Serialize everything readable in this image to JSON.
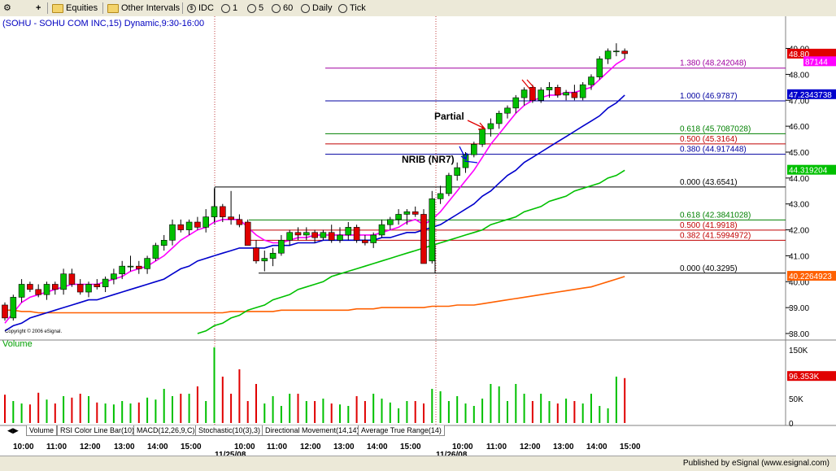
{
  "toolbar": {
    "items": [
      "Equities",
      "Other Intervals",
      "IDC",
      "1",
      "5",
      "60",
      "Daily",
      "Tick"
    ]
  },
  "chart_title": "(SOHU - SOHU COM INC,15) Dynamic,9:30-16:00",
  "copyright": "Copyright © 2006 eSignal.",
  "volume_label": "Volume",
  "annotations": [
    "Partial",
    "NRIB (NR7)"
  ],
  "price_axis": [
    "49.00",
    "48.00",
    "47.00",
    "46.00",
    "45.00",
    "44.00",
    "43.00",
    "42.00",
    "41.00",
    "40.00",
    "39.00",
    "38.00"
  ],
  "volume_axis": [
    "150K",
    "100K",
    "50K",
    "0"
  ],
  "time_axis": [
    "10:00",
    "11:00",
    "12:00",
    "13:00",
    "14:00",
    "15:00",
    "10:00",
    "11:00",
    "12:00",
    "13:00",
    "14:00",
    "15:00",
    "10:00",
    "11:00",
    "12:00",
    "13:00",
    "14:00",
    "15:00"
  ],
  "dates": [
    "11/25/08",
    "11/26/08"
  ],
  "price_tags": [
    "48.80",
    "87144",
    "47.2343738",
    "44.319204",
    "40.2264923"
  ],
  "volume_tag": "96.353K",
  "fib_labels": [
    {
      "text": "1.380 (48.242048)",
      "color": "#a000a0"
    },
    {
      "text": "1.000 (46.9787)",
      "color": "#0000a0"
    },
    {
      "text": "0.618 (45.7087028)",
      "color": "#008000"
    },
    {
      "text": "0.500 (45.3164)",
      "color": "#c00000"
    },
    {
      "text": "0.380 (44.917448)",
      "color": "#0000a0"
    },
    {
      "text": "0.000 (43.6541)",
      "color": "#000000"
    },
    {
      "text": "0.618 (42.3841028)",
      "color": "#008000"
    },
    {
      "text": "0.500 (41.9918)",
      "color": "#c00000"
    },
    {
      "text": "0.382 (41.5994972)",
      "color": "#c00000"
    },
    {
      "text": "0.000 (40.3295)",
      "color": "#000000"
    }
  ],
  "tabs": [
    "Volume",
    "RSI Color Line Bar(10)",
    "MACD(12,26,9,C)",
    "Stochastic(10(3),3)",
    "Directional Movement(14,14)",
    "Average True Range(14)"
  ],
  "status": "Published by eSignal (www.esignal.com)",
  "colors": {
    "up": "#00c000",
    "down": "#e00000",
    "ma_fast": "#ff00ff",
    "ma_mid": "#0000cc",
    "ma_slow": "#00c000",
    "ma_long": "#ff6000"
  },
  "chart_data": {
    "type": "candlestick",
    "title": "(SOHU - SOHU COM INC,15) Dynamic,9:30-16:00",
    "ylim": [
      38.0,
      49.3
    ],
    "bars": [
      [
        39.1,
        39.2,
        38.5,
        38.6
      ],
      [
        38.6,
        39.5,
        38.5,
        39.4
      ],
      [
        39.4,
        40.1,
        39.2,
        39.9
      ],
      [
        39.9,
        40.0,
        39.6,
        39.7
      ],
      [
        39.7,
        39.9,
        39.4,
        39.5
      ],
      [
        39.5,
        40.0,
        39.3,
        39.9
      ],
      [
        39.9,
        40.0,
        39.5,
        39.7
      ],
      [
        39.7,
        40.5,
        39.5,
        40.3
      ],
      [
        40.3,
        40.5,
        39.8,
        39.9
      ],
      [
        39.9,
        40.1,
        39.5,
        39.6
      ],
      [
        39.6,
        40.0,
        39.4,
        39.9
      ],
      [
        39.9,
        40.1,
        39.7,
        39.8
      ],
      [
        39.8,
        40.2,
        39.6,
        40.1
      ],
      [
        40.1,
        40.5,
        39.9,
        40.3
      ],
      [
        40.3,
        40.8,
        40.1,
        40.6
      ],
      [
        40.6,
        41.0,
        40.4,
        40.6
      ],
      [
        40.6,
        40.8,
        40.3,
        40.5
      ],
      [
        40.5,
        41.0,
        40.3,
        40.9
      ],
      [
        40.9,
        41.5,
        40.8,
        41.4
      ],
      [
        41.4,
        41.8,
        41.2,
        41.6
      ],
      [
        41.6,
        42.4,
        41.4,
        42.2
      ],
      [
        42.2,
        42.4,
        41.9,
        42.0
      ],
      [
        42.0,
        42.4,
        41.8,
        42.3
      ],
      [
        42.3,
        42.5,
        42.0,
        42.1
      ],
      [
        42.1,
        42.8,
        41.9,
        42.5
      ],
      [
        42.5,
        43.6,
        42.3,
        42.9
      ],
      [
        42.9,
        43.0,
        42.3,
        42.5
      ],
      [
        42.5,
        43.5,
        42.2,
        42.4
      ],
      [
        42.4,
        42.6,
        42.1,
        42.2
      ],
      [
        42.3,
        42.4,
        41.4,
        41.4
      ],
      [
        41.3,
        41.6,
        40.7,
        40.8
      ],
      [
        40.8,
        41.2,
        40.4,
        40.9
      ],
      [
        40.9,
        41.3,
        40.6,
        41.1
      ],
      [
        41.1,
        41.8,
        41.0,
        41.6
      ],
      [
        41.6,
        42.0,
        41.4,
        41.9
      ],
      [
        41.9,
        42.1,
        41.6,
        41.8
      ],
      [
        41.8,
        42.1,
        41.6,
        41.9
      ],
      [
        41.9,
        42.0,
        41.5,
        41.7
      ],
      [
        41.7,
        42.0,
        41.6,
        41.9
      ],
      [
        41.9,
        42.2,
        41.5,
        41.6
      ],
      [
        41.6,
        42.1,
        41.5,
        41.8
      ],
      [
        41.8,
        42.3,
        41.6,
        42.1
      ],
      [
        42.1,
        42.2,
        41.5,
        41.6
      ],
      [
        41.6,
        41.8,
        41.4,
        41.5
      ],
      [
        41.5,
        41.9,
        41.3,
        41.8
      ],
      [
        41.8,
        42.4,
        41.7,
        42.2
      ],
      [
        42.2,
        42.5,
        42.0,
        42.4
      ],
      [
        42.4,
        42.8,
        42.2,
        42.6
      ],
      [
        42.6,
        42.8,
        42.2,
        42.7
      ],
      [
        42.7,
        42.9,
        42.5,
        42.6
      ],
      [
        42.6,
        42.8,
        41.5,
        40.7
      ],
      [
        40.8,
        43.5,
        40.7,
        43.2
      ],
      [
        43.2,
        43.7,
        43.0,
        43.4
      ],
      [
        43.4,
        44.2,
        43.3,
        44.1
      ],
      [
        44.1,
        44.6,
        43.9,
        44.4
      ],
      [
        44.4,
        45.0,
        44.2,
        44.9
      ],
      [
        44.9,
        45.4,
        44.8,
        45.3
      ],
      [
        45.3,
        46.0,
        45.2,
        45.9
      ],
      [
        45.9,
        46.3,
        45.6,
        46.1
      ],
      [
        46.1,
        46.6,
        45.9,
        46.5
      ],
      [
        46.5,
        46.8,
        46.3,
        46.7
      ],
      [
        46.7,
        47.2,
        46.5,
        47.1
      ],
      [
        47.1,
        47.5,
        46.8,
        47.4
      ],
      [
        47.5,
        47.6,
        46.9,
        47.0
      ],
      [
        47.0,
        47.5,
        46.9,
        47.4
      ],
      [
        47.4,
        47.7,
        47.1,
        47.5
      ],
      [
        47.5,
        47.6,
        47.1,
        47.2
      ],
      [
        47.2,
        47.4,
        47.0,
        47.3
      ],
      [
        47.3,
        47.6,
        47.0,
        47.1
      ],
      [
        47.1,
        47.7,
        47.0,
        47.6
      ],
      [
        47.6,
        48.0,
        47.4,
        47.9
      ],
      [
        47.9,
        48.7,
        47.8,
        48.6
      ],
      [
        48.6,
        49.0,
        48.4,
        48.9
      ],
      [
        48.9,
        49.2,
        48.7,
        48.9
      ],
      [
        48.9,
        49.0,
        48.6,
        48.8
      ]
    ],
    "volume": [
      58,
      45,
      40,
      38,
      62,
      48,
      40,
      55,
      52,
      60,
      55,
      42,
      40,
      38,
      45,
      40,
      42,
      52,
      48,
      70,
      55,
      60,
      60,
      75,
      45,
      155,
      95,
      60,
      110,
      45,
      80,
      40,
      55,
      35,
      60,
      60,
      45,
      45,
      50,
      40,
      38,
      35,
      55,
      45,
      60,
      50,
      42,
      30,
      45,
      45,
      40,
      70,
      65,
      45,
      55,
      40,
      35,
      50,
      80,
      75,
      45,
      80,
      60,
      45,
      60,
      45,
      40,
      50,
      45,
      40,
      60,
      35,
      30,
      95,
      92
    ],
    "ma_fast": [
      38.4,
      38.8,
      39.2,
      39.4,
      39.5,
      39.6,
      39.7,
      39.8,
      39.9,
      39.9,
      39.9,
      39.9,
      40.0,
      40.1,
      40.2,
      40.4,
      40.5,
      40.6,
      40.8,
      41.0,
      41.3,
      41.6,
      41.8,
      42.0,
      42.1,
      42.3,
      42.4,
      42.4,
      42.4,
      42.1,
      41.8,
      41.6,
      41.5,
      41.5,
      41.6,
      41.7,
      41.7,
      41.8,
      41.8,
      41.8,
      41.8,
      41.8,
      41.8,
      41.8,
      41.8,
      41.9,
      42.0,
      42.1,
      42.3,
      42.4,
      42.2,
      42.4,
      42.7,
      43.1,
      43.5,
      43.9,
      44.3,
      44.8,
      45.3,
      45.7,
      46.1,
      46.5,
      46.8,
      47.0,
      47.1,
      47.2,
      47.2,
      47.3,
      47.3,
      47.4,
      47.5,
      47.8,
      48.1,
      48.4,
      48.6
    ],
    "ma_mid": [
      38.1,
      38.3,
      38.4,
      38.6,
      38.7,
      38.8,
      38.9,
      39.0,
      39.1,
      39.2,
      39.3,
      39.3,
      39.4,
      39.5,
      39.6,
      39.7,
      39.8,
      39.9,
      40.0,
      40.1,
      40.3,
      40.5,
      40.6,
      40.8,
      40.9,
      41.0,
      41.1,
      41.2,
      41.3,
      41.3,
      41.3,
      41.3,
      41.4,
      41.4,
      41.4,
      41.5,
      41.5,
      41.5,
      41.6,
      41.6,
      41.6,
      41.6,
      41.6,
      41.6,
      41.6,
      41.7,
      41.7,
      41.8,
      41.9,
      41.9,
      42.0,
      42.1,
      42.2,
      42.4,
      42.6,
      42.8,
      43.0,
      43.3,
      43.5,
      43.8,
      44.1,
      44.3,
      44.6,
      44.8,
      45.0,
      45.2,
      45.4,
      45.6,
      45.8,
      46.0,
      46.2,
      46.4,
      46.7,
      46.9,
      47.2
    ],
    "ma_slow": [
      null,
      null,
      null,
      null,
      null,
      null,
      null,
      null,
      null,
      null,
      null,
      null,
      null,
      null,
      null,
      null,
      null,
      null,
      null,
      null,
      null,
      null,
      null,
      38.0,
      38.1,
      38.3,
      38.4,
      38.6,
      38.7,
      38.9,
      39.0,
      39.1,
      39.3,
      39.4,
      39.5,
      39.7,
      39.8,
      39.9,
      40.0,
      40.2,
      40.3,
      40.4,
      40.5,
      40.6,
      40.7,
      40.8,
      40.9,
      41.0,
      41.1,
      41.2,
      41.3,
      41.4,
      41.5,
      41.6,
      41.7,
      41.8,
      41.9,
      42.0,
      42.2,
      42.3,
      42.4,
      42.5,
      42.7,
      42.8,
      42.9,
      43.1,
      43.2,
      43.3,
      43.5,
      43.6,
      43.7,
      43.8,
      44.0,
      44.1,
      44.3
    ],
    "ma_long": [
      38.9,
      38.9,
      38.85,
      38.85,
      38.8,
      38.8,
      38.8,
      38.8,
      38.8,
      38.8,
      38.8,
      38.8,
      38.8,
      38.8,
      38.8,
      38.8,
      38.8,
      38.8,
      38.8,
      38.8,
      38.8,
      38.8,
      38.8,
      38.8,
      38.8,
      38.8,
      38.8,
      38.85,
      38.85,
      38.85,
      38.85,
      38.85,
      38.85,
      38.9,
      38.9,
      38.9,
      38.9,
      38.9,
      38.9,
      38.9,
      38.9,
      38.9,
      38.95,
      38.95,
      38.95,
      39.0,
      39.0,
      39.0,
      39.0,
      39.0,
      39.0,
      39.05,
      39.05,
      39.05,
      39.1,
      39.1,
      39.1,
      39.15,
      39.2,
      39.25,
      39.3,
      39.35,
      39.4,
      39.45,
      39.5,
      39.55,
      39.6,
      39.65,
      39.7,
      39.75,
      39.8,
      39.9,
      40.0,
      40.1,
      40.2
    ],
    "fib_levels": [
      48.242048,
      46.9787,
      45.7087028,
      45.3164,
      44.917448,
      43.6541,
      42.3841028,
      41.9918,
      41.5994972,
      40.3295
    ]
  }
}
